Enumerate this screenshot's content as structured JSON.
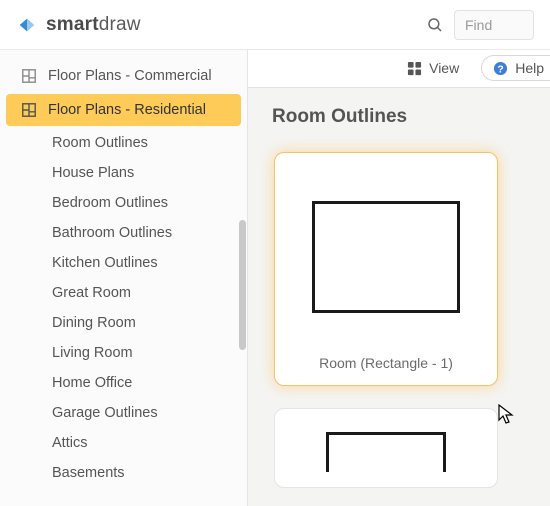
{
  "brand": {
    "bold": "smart",
    "light": "draw"
  },
  "search": {
    "placeholder": "Find"
  },
  "toolbar": {
    "view": "View",
    "help": "Help"
  },
  "sidebar": {
    "categories": [
      {
        "label": "Floor Plans - Commercial"
      },
      {
        "label": "Floor Plans - Residential"
      }
    ],
    "subitems": [
      {
        "label": "Room Outlines"
      },
      {
        "label": "House Plans"
      },
      {
        "label": "Bedroom Outlines"
      },
      {
        "label": "Bathroom Outlines"
      },
      {
        "label": "Kitchen Outlines"
      },
      {
        "label": "Great Room"
      },
      {
        "label": "Dining Room"
      },
      {
        "label": "Living Room"
      },
      {
        "label": "Home Office"
      },
      {
        "label": "Garage Outlines"
      },
      {
        "label": "Attics"
      },
      {
        "label": "Basements"
      }
    ]
  },
  "main": {
    "title": "Room Outlines",
    "cards": [
      {
        "label": "Room (Rectangle - 1)"
      },
      {
        "label": ""
      }
    ]
  }
}
